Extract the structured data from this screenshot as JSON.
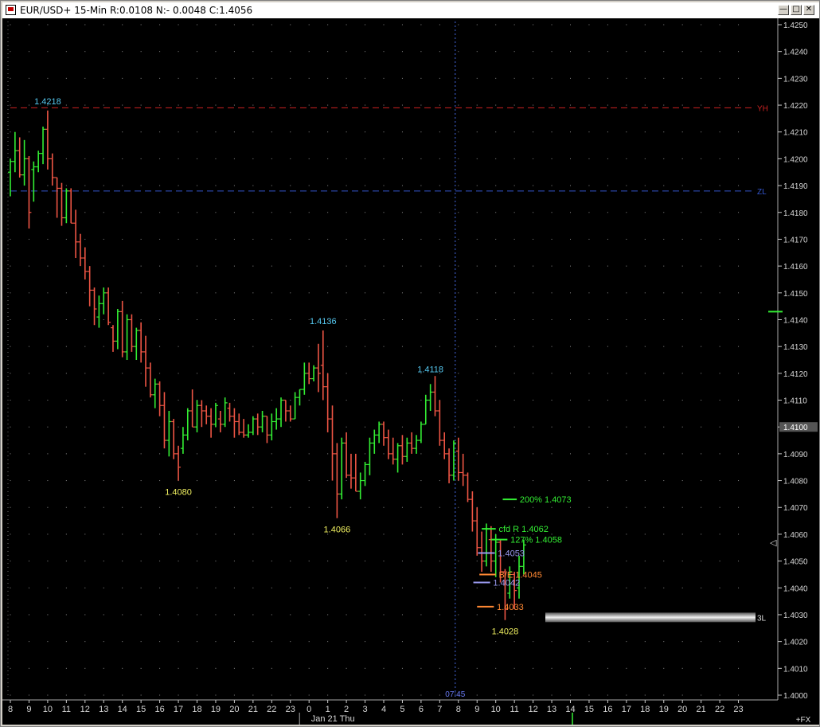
{
  "window": {
    "title": "EUR/USD+ 15-Min R:0.0108 N:- 0.0048 C:1.4056",
    "minimize_icon": "minimize-icon",
    "restore_icon": "restore-icon",
    "close_icon": "close-icon"
  },
  "chart_data": {
    "type": "ohlc",
    "title": "EUR/USD+ 15-Min R:0.0108 N:- 0.0048 C:1.4056",
    "colors": {
      "up": "#33ee33",
      "down": "#ee5544",
      "background": "#000000",
      "grid_dot": "#8a8a8a"
    },
    "ylim": [
      1.4,
      1.4255
    ],
    "y_ticks": [
      "1.4250",
      "1.4240",
      "1.4230",
      "1.4220",
      "1.4210",
      "1.4200",
      "1.4190",
      "1.4180",
      "1.4170",
      "1.4160",
      "1.4150",
      "1.4140",
      "1.4130",
      "1.4120",
      "1.4110",
      "1.4100",
      "1.4090",
      "1.4080",
      "1.4070",
      "1.4060",
      "1.4050",
      "1.4040",
      "1.4030",
      "1.4020",
      "1.4010",
      "1.4000"
    ],
    "x_tick_labels": [
      "8",
      "9",
      "10",
      "11",
      "12",
      "13",
      "14",
      "15",
      "16",
      "17",
      "18",
      "19",
      "20",
      "21",
      "22",
      "23",
      "0",
      "1",
      "2",
      "3",
      "4",
      "5",
      "6",
      "7",
      "8",
      "9",
      "10",
      "11",
      "12",
      "13",
      "14",
      "15",
      "16",
      "17",
      "18",
      "19",
      "20",
      "21",
      "22",
      "23"
    ],
    "x_date_label": "Jan 21 Thu",
    "crosshair_time": "07:45",
    "crosshair_value": "1.4100",
    "current_tick_marker": "+FX",
    "grid": true,
    "bars": [
      [
        1.4195,
        1.42,
        1.4186,
        1.4199
      ],
      [
        1.4199,
        1.421,
        1.4195,
        1.4203
      ],
      [
        1.4203,
        1.4208,
        1.4193,
        1.4194
      ],
      [
        1.4194,
        1.4207,
        1.419,
        1.42
      ],
      [
        1.42,
        1.4201,
        1.4174,
        1.418
      ],
      [
        1.4196,
        1.4199,
        1.4184,
        1.4197
      ],
      [
        1.4197,
        1.4203,
        1.4195,
        1.4202
      ],
      [
        1.4202,
        1.4212,
        1.4198,
        1.4211
      ],
      [
        1.4211,
        1.4218,
        1.4196,
        1.42
      ],
      [
        1.42,
        1.4202,
        1.419,
        1.4193
      ],
      [
        1.4193,
        1.4193,
        1.4178,
        1.4189
      ],
      [
        1.4189,
        1.4191,
        1.4175,
        1.4178
      ],
      [
        1.4178,
        1.4189,
        1.4176,
        1.4188
      ],
      [
        1.4188,
        1.4189,
        1.4176,
        1.4176
      ],
      [
        1.4176,
        1.4181,
        1.4163,
        1.4169
      ],
      [
        1.4169,
        1.4172,
        1.416,
        1.4163
      ],
      [
        1.4163,
        1.4167,
        1.4155,
        1.4158
      ],
      [
        1.4158,
        1.416,
        1.4145,
        1.4151
      ],
      [
        1.4151,
        1.4152,
        1.4138,
        1.4144
      ],
      [
        1.4141,
        1.4149,
        1.4137,
        1.4146
      ],
      [
        1.4146,
        1.4152,
        1.4142,
        1.415
      ],
      [
        1.415,
        1.4152,
        1.4138,
        1.4139
      ],
      [
        1.4137,
        1.4138,
        1.4128,
        1.4132
      ],
      [
        1.4132,
        1.4144,
        1.4129,
        1.4143
      ],
      [
        1.4143,
        1.4147,
        1.4126,
        1.4128
      ],
      [
        1.4128,
        1.4142,
        1.4125,
        1.414
      ],
      [
        1.414,
        1.4142,
        1.4128,
        1.413
      ],
      [
        1.413,
        1.4137,
        1.4125,
        1.4136
      ],
      [
        1.4136,
        1.4139,
        1.4124,
        1.4128
      ],
      [
        1.4128,
        1.4134,
        1.4115,
        1.4122
      ],
      [
        1.4122,
        1.4124,
        1.4111,
        1.4112
      ],
      [
        1.4112,
        1.4118,
        1.4107,
        1.4116
      ],
      [
        1.4116,
        1.4117,
        1.4104,
        1.4108
      ],
      [
        1.4108,
        1.4113,
        1.4092,
        1.4095
      ],
      [
        1.4095,
        1.4106,
        1.4089,
        1.4102
      ],
      [
        1.4102,
        1.4103,
        1.4088,
        1.409
      ],
      [
        1.409,
        1.4093,
        1.408,
        1.4085
      ],
      [
        1.4092,
        1.41,
        1.409,
        1.4097
      ],
      [
        1.4097,
        1.4107,
        1.4095,
        1.4106
      ],
      [
        1.4106,
        1.4114,
        1.41,
        1.41
      ],
      [
        1.41,
        1.411,
        1.4098,
        1.4108
      ],
      [
        1.4108,
        1.411,
        1.41,
        1.4106
      ],
      [
        1.4106,
        1.4108,
        1.4101,
        1.4104
      ],
      [
        1.4104,
        1.4107,
        1.4096,
        1.4101
      ],
      [
        1.4101,
        1.4109,
        1.41,
        1.4108
      ],
      [
        1.4103,
        1.4106,
        1.4098,
        1.4101
      ],
      [
        1.4101,
        1.4111,
        1.41,
        1.4109
      ],
      [
        1.4107,
        1.4109,
        1.4102,
        1.4104
      ],
      [
        1.4104,
        1.4107,
        1.4096,
        1.4102
      ],
      [
        1.4102,
        1.4105,
        1.4097,
        1.4098
      ],
      [
        1.4098,
        1.4103,
        1.4096,
        1.4097
      ],
      [
        1.4097,
        1.4101,
        1.4096,
        1.4098
      ],
      [
        1.4098,
        1.4104,
        1.4097,
        1.4103
      ],
      [
        1.4103,
        1.4105,
        1.4097,
        1.41
      ],
      [
        1.41,
        1.4106,
        1.4098,
        1.4104
      ],
      [
        1.4104,
        1.4104,
        1.4094,
        1.4097
      ],
      [
        1.4097,
        1.4105,
        1.4095,
        1.4102
      ],
      [
        1.4102,
        1.4107,
        1.4099,
        1.4103
      ],
      [
        1.4103,
        1.4111,
        1.41,
        1.411
      ],
      [
        1.411,
        1.411,
        1.4102,
        1.4106
      ],
      [
        1.4106,
        1.4108,
        1.4102,
        1.4103
      ],
      [
        1.4103,
        1.4113,
        1.4103,
        1.4111
      ],
      [
        1.4111,
        1.4114,
        1.4108,
        1.4114
      ],
      [
        1.4114,
        1.4124,
        1.4112,
        1.412
      ],
      [
        1.412,
        1.4124,
        1.4116,
        1.4118
      ],
      [
        1.4118,
        1.4123,
        1.4117,
        1.4122
      ],
      [
        1.4122,
        1.4131,
        1.4113,
        1.412
      ],
      [
        1.4123,
        1.4136,
        1.411,
        1.4115
      ],
      [
        1.4115,
        1.412,
        1.4098,
        1.4103
      ],
      [
        1.4103,
        1.4108,
        1.408,
        1.409
      ],
      [
        1.409,
        1.4094,
        1.4066,
        1.4075
      ],
      [
        1.4075,
        1.4096,
        1.4073,
        1.4094
      ],
      [
        1.4094,
        1.4098,
        1.4081,
        1.4082
      ],
      [
        1.4082,
        1.409,
        1.4077,
        1.4081
      ],
      [
        1.4081,
        1.409,
        1.4076,
        1.4076
      ],
      [
        1.4076,
        1.4083,
        1.4073,
        1.408
      ],
      [
        1.408,
        1.4087,
        1.4078,
        1.4086
      ],
      [
        1.4086,
        1.4096,
        1.4082,
        1.4094
      ],
      [
        1.4094,
        1.4099,
        1.409,
        1.4097
      ],
      [
        1.4097,
        1.4102,
        1.4094,
        1.4101
      ],
      [
        1.4101,
        1.4102,
        1.4093,
        1.4096
      ],
      [
        1.4096,
        1.4099,
        1.4088,
        1.409
      ],
      [
        1.409,
        1.4096,
        1.4086,
        1.4088
      ],
      [
        1.4088,
        1.4094,
        1.4083,
        1.4093
      ],
      [
        1.4093,
        1.4097,
        1.4086,
        1.4089
      ],
      [
        1.4089,
        1.4096,
        1.4087,
        1.4094
      ],
      [
        1.4094,
        1.4098,
        1.409,
        1.4092
      ],
      [
        1.4092,
        1.4097,
        1.409,
        1.4095
      ],
      [
        1.4095,
        1.4102,
        1.4094,
        1.4101
      ],
      [
        1.4101,
        1.4112,
        1.4101,
        1.411
      ],
      [
        1.411,
        1.4116,
        1.4106,
        1.4113
      ],
      [
        1.4113,
        1.4119,
        1.4104,
        1.4106
      ],
      [
        1.4106,
        1.411,
        1.4093,
        1.4095
      ],
      [
        1.4095,
        1.4098,
        1.4088,
        1.409
      ],
      [
        1.409,
        1.4092,
        1.4079,
        1.4082
      ],
      [
        1.4082,
        1.4095,
        1.408,
        1.4094
      ],
      [
        1.4091,
        1.4096,
        1.408,
        1.4083
      ],
      [
        1.4083,
        1.409,
        1.4078,
        1.4082
      ],
      [
        1.4082,
        1.4083,
        1.4072,
        1.4073
      ],
      [
        1.4073,
        1.4076,
        1.4061,
        1.4065
      ],
      [
        1.4065,
        1.407,
        1.4052,
        1.4055
      ],
      [
        1.4055,
        1.4061,
        1.4046,
        1.405
      ],
      [
        1.405,
        1.4064,
        1.4048,
        1.4062
      ],
      [
        1.4058,
        1.4063,
        1.4046,
        1.405
      ],
      [
        1.405,
        1.406,
        1.4044,
        1.4057
      ],
      [
        1.4057,
        1.4058,
        1.4042,
        1.4046
      ],
      [
        1.4046,
        1.4047,
        1.4028,
        1.4032
      ],
      [
        1.4038,
        1.4048,
        1.4036,
        1.4046
      ],
      [
        1.4045,
        1.4046,
        1.4032,
        1.4039
      ],
      [
        1.404,
        1.4052,
        1.4036,
        1.4048
      ],
      [
        1.4048,
        1.4058,
        1.4045,
        1.4056
      ]
    ],
    "price_annotations": [
      {
        "label": "1.4218",
        "value": 1.4218,
        "bar": 8,
        "pos": "above",
        "color": "#55c8f0"
      },
      {
        "label": "1.4080",
        "value": 1.408,
        "bar": 36,
        "pos": "below",
        "color": "#f0f060"
      },
      {
        "label": "1.4136",
        "value": 1.4136,
        "bar": 67,
        "pos": "above",
        "color": "#55c8f0"
      },
      {
        "label": "1.4066",
        "value": 1.4066,
        "bar": 70,
        "pos": "below",
        "color": "#f0f060"
      },
      {
        "label": "1.4118",
        "value": 1.4118,
        "bar": 90,
        "pos": "above",
        "color": "#55c8f0"
      },
      {
        "label": "1.4028",
        "value": 1.4028,
        "bar": 106,
        "pos": "below",
        "color": "#f0f060"
      }
    ],
    "reference_lines": [
      {
        "label": "YH",
        "value": 1.4219,
        "color": "#cc2222"
      },
      {
        "label": "ZL",
        "value": 1.4188,
        "color": "#3355cc"
      }
    ],
    "targets": [
      {
        "label": "200% 1.4073",
        "value": 1.4073,
        "color": "#33ee33",
        "col_start": 105.5,
        "col_end": 108.5,
        "label_col": 108.8
      },
      {
        "label": "cfd R 1.4062",
        "value": 1.4062,
        "color": "#33ee33",
        "col_start": 101.0,
        "col_end": 104.0,
        "label_col": 104.3
      },
      {
        "label": "127% 1.4058",
        "value": 1.4058,
        "color": "#33ee33",
        "col_start": 103.0,
        "col_end": 106.5,
        "label_col": 106.8
      },
      {
        "label": "1.4053",
        "value": 1.4053,
        "color": "#9999ee",
        "col_start": 100.2,
        "col_end": 103.8,
        "label_col": 104.1
      },
      {
        "label": "B/E 1.4045",
        "value": 1.4045,
        "color": "#ff8833",
        "col_start": 100.5,
        "col_end": 104.0,
        "label_col": 104.3
      },
      {
        "label": "1.4042",
        "value": 1.4042,
        "color": "#9999ee",
        "col_start": 99.2,
        "col_end": 102.8,
        "label_col": 103.1
      },
      {
        "label": "1.4033",
        "value": 1.4033,
        "color": "#ff8833",
        "col_start": 100.0,
        "col_end": 103.6,
        "label_col": 103.9
      }
    ],
    "level_3l": {
      "label": "3L",
      "value": 1.4029
    }
  }
}
